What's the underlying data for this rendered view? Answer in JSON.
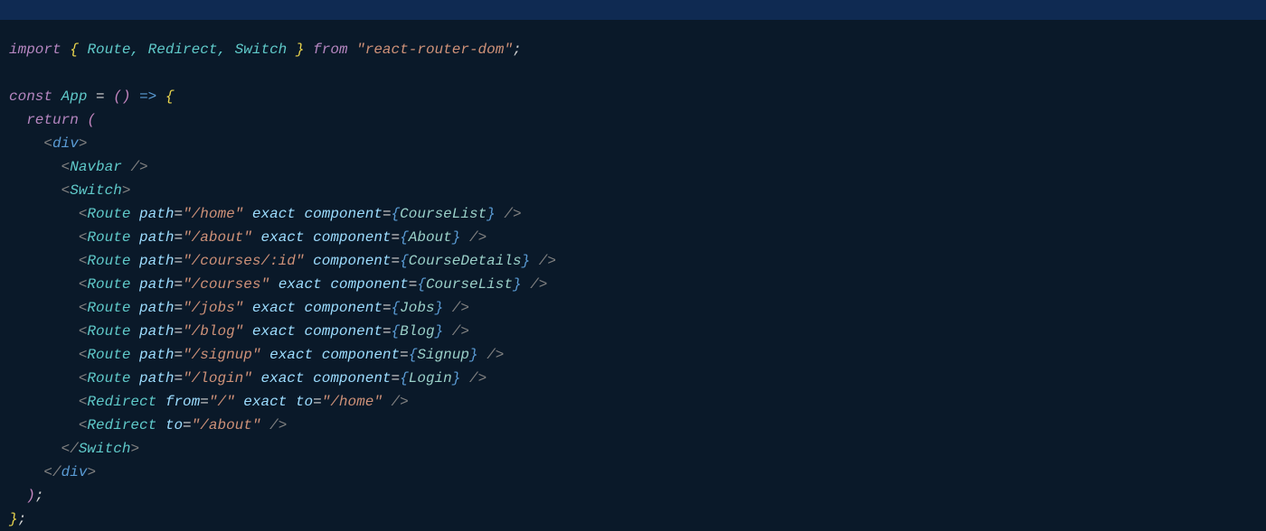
{
  "titlebar": {},
  "code": {
    "line1": {
      "kw_import": "import",
      "brace_open": "{",
      "names": "Route, Redirect, Switch",
      "brace_close": "}",
      "kw_from": "from",
      "module": "\"react-router-dom\"",
      "semi": ";"
    },
    "line3": {
      "kw_const": "const",
      "name": "App",
      "eq": "=",
      "parens": "()",
      "arrow": "=>",
      "brace": "{"
    },
    "line4": {
      "kw_return": "return",
      "paren": "("
    },
    "line5_open_div": "<div>",
    "line6_navbar": "<Navbar />",
    "line7_switch_open": "<Switch>",
    "routes": [
      {
        "tag": "Route",
        "path": "\"/home\"",
        "exact": true,
        "component": "CourseList"
      },
      {
        "tag": "Route",
        "path": "\"/about\"",
        "exact": true,
        "component": "About"
      },
      {
        "tag": "Route",
        "path": "\"/courses/:id\"",
        "exact": false,
        "component": "CourseDetails"
      },
      {
        "tag": "Route",
        "path": "\"/courses\"",
        "exact": true,
        "component": "CourseList"
      },
      {
        "tag": "Route",
        "path": "\"/jobs\"",
        "exact": true,
        "component": "Jobs"
      },
      {
        "tag": "Route",
        "path": "\"/blog\"",
        "exact": true,
        "component": "Blog"
      },
      {
        "tag": "Route",
        "path": "\"/signup\"",
        "exact": true,
        "component": "Signup"
      },
      {
        "tag": "Route",
        "path": "\"/login\"",
        "exact": true,
        "component": "Login"
      }
    ],
    "redirect1": {
      "tag": "Redirect",
      "from": "\"/\"",
      "exact": true,
      "to": "\"/home\""
    },
    "redirect2": {
      "tag": "Redirect",
      "to": "\"/about\""
    },
    "line18_switch_close": "</Switch>",
    "line19_div_close": "</div>",
    "line20_paren_close": ");",
    "line21_brace_close": "};",
    "labels": {
      "lt": "<",
      "gt": ">",
      "slash": "/",
      "sp": " ",
      "eq": "=",
      "lcb": "{",
      "rcb": "}",
      "path_attr": "path",
      "exact_attr": "exact",
      "component_attr": "component",
      "from_attr": "from",
      "to_attr": "to",
      "route_tag": "Route",
      "redirect_tag": "Redirect",
      "switch_tag": "Switch",
      "div_tag": "div",
      "navbar_tag": "Navbar"
    }
  }
}
